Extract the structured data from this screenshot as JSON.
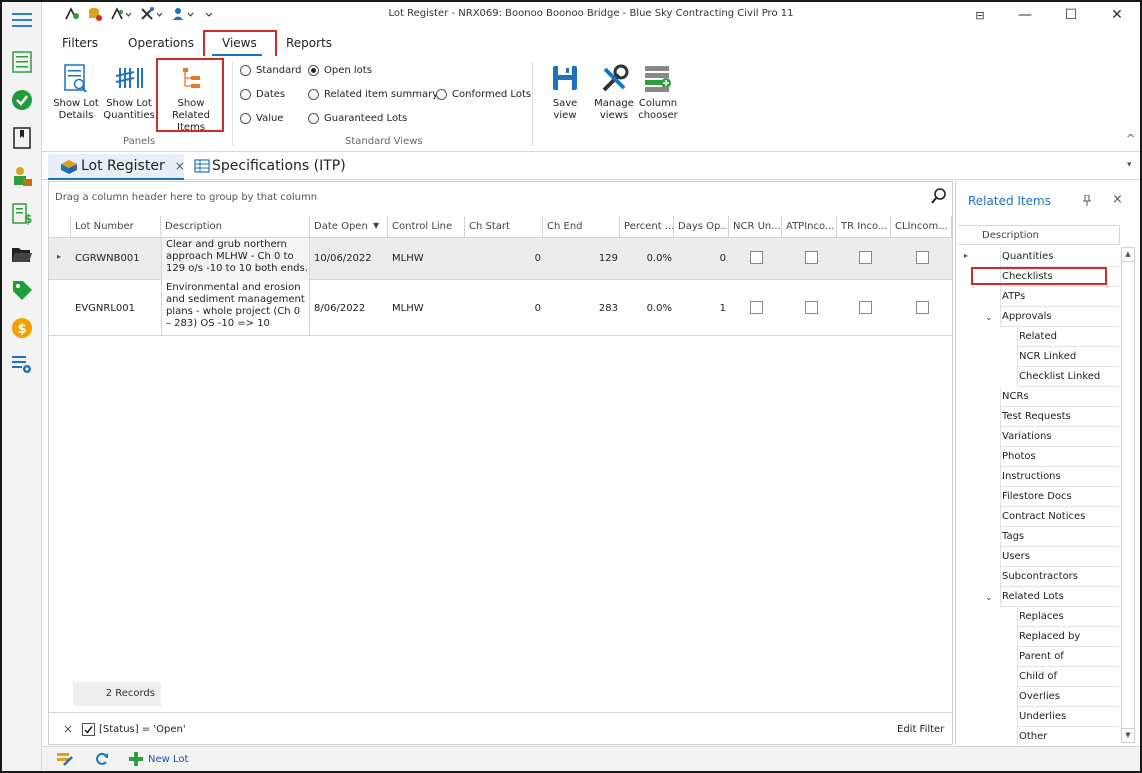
{
  "window": {
    "title": "Lot Register - NRX069: Boonoo Boonoo Bridge  - Blue Sky Contracting Civil Pro 11",
    "minimize": "—",
    "maximize": "☐",
    "close": "✕",
    "restore_icon": "⊟"
  },
  "menu": {
    "tabs": [
      "Filters",
      "Operations",
      "Views",
      "Reports"
    ],
    "active": "Views"
  },
  "ribbon": {
    "panels_group_label": "Panels",
    "show_lot_details": [
      "Show Lot",
      "Details"
    ],
    "show_lot_quantities": [
      "Show Lot",
      "Quantities"
    ],
    "show_related_items": [
      "Show Related",
      "Items"
    ],
    "standard_views_label": "Standard Views",
    "radios": {
      "standard": "Standard",
      "open_lots": "Open lots",
      "dates": "Dates",
      "related_item_summary": "Related item summary",
      "conformed_lots": "Conformed Lots",
      "value": "Value",
      "guaranteed_lots": "Guaranteed Lots"
    },
    "selected_radio": "open_lots",
    "save_view": "Save view",
    "manage_views": [
      "Manage",
      "views"
    ],
    "column_chooser": [
      "Column",
      "chooser"
    ]
  },
  "doc_tabs": {
    "lot_register": "Lot Register",
    "close_glyph": "×",
    "specifications": "Specifications (ITP)"
  },
  "grid": {
    "group_hint": "Drag a column header here to group by that column",
    "columns": [
      "Lot Number",
      "Description",
      "Date Open",
      "Control Line",
      "Ch Start",
      "Ch End",
      "Percent ...",
      "Days Op...",
      "NCR Un...",
      "ATPInco...",
      "TR Inco...",
      "CLIncom..."
    ],
    "rows": [
      {
        "lot_number": "CGRWNB001",
        "description": "Clear and grub northern approach MLHW - Ch 0 to 129 o/s -10 to 10 both ends.",
        "date_open": "10/06/2022",
        "control_line": "MLHW",
        "ch_start": "0",
        "ch_end": "129",
        "percent": "0.0%",
        "days_open": "0"
      },
      {
        "lot_number": "EVGNRL001",
        "description": "Environmental and erosion and sediment management plans - whole project (Ch 0 – 283) OS -10 => 10",
        "date_open": "8/06/2022",
        "control_line": "MLHW",
        "ch_start": "0",
        "ch_end": "283",
        "percent": "0.0%",
        "days_open": "1"
      }
    ],
    "records": "2 Records",
    "filter_text": "[Status] = 'Open'",
    "edit_filter": "Edit Filter"
  },
  "related_panel": {
    "title": "Related Items",
    "column": "Description",
    "items": [
      {
        "label": "Quantities",
        "level": 0
      },
      {
        "label": "Checklists",
        "level": 0
      },
      {
        "label": "ATPs",
        "level": 0
      },
      {
        "label": "Approvals",
        "level": 0
      },
      {
        "label": "Related",
        "level": 1
      },
      {
        "label": "NCR Linked",
        "level": 1
      },
      {
        "label": "Checklist Linked",
        "level": 1
      },
      {
        "label": "NCRs",
        "level": 0
      },
      {
        "label": "Test Requests",
        "level": 0
      },
      {
        "label": "Variations",
        "level": 0
      },
      {
        "label": "Photos",
        "level": 0
      },
      {
        "label": "Instructions",
        "level": 0
      },
      {
        "label": "Filestore Docs",
        "level": 0
      },
      {
        "label": "Contract Notices",
        "level": 0
      },
      {
        "label": "Tags",
        "level": 0
      },
      {
        "label": "Users",
        "level": 0
      },
      {
        "label": "Subcontractors",
        "level": 0
      },
      {
        "label": "Related Lots",
        "level": 0
      },
      {
        "label": "Replaces",
        "level": 1
      },
      {
        "label": "Replaced by",
        "level": 1
      },
      {
        "label": "Parent of",
        "level": 1
      },
      {
        "label": "Child of",
        "level": 1
      },
      {
        "label": "Overlies",
        "level": 1
      },
      {
        "label": "Underlies",
        "level": 1
      },
      {
        "label": "Other",
        "level": 1
      }
    ]
  },
  "bottom": {
    "new_lot": "New Lot"
  },
  "colors": {
    "accent_blue": "#1e73be",
    "highlight_red": "#d12b2b",
    "green": "#2e9e3e"
  }
}
